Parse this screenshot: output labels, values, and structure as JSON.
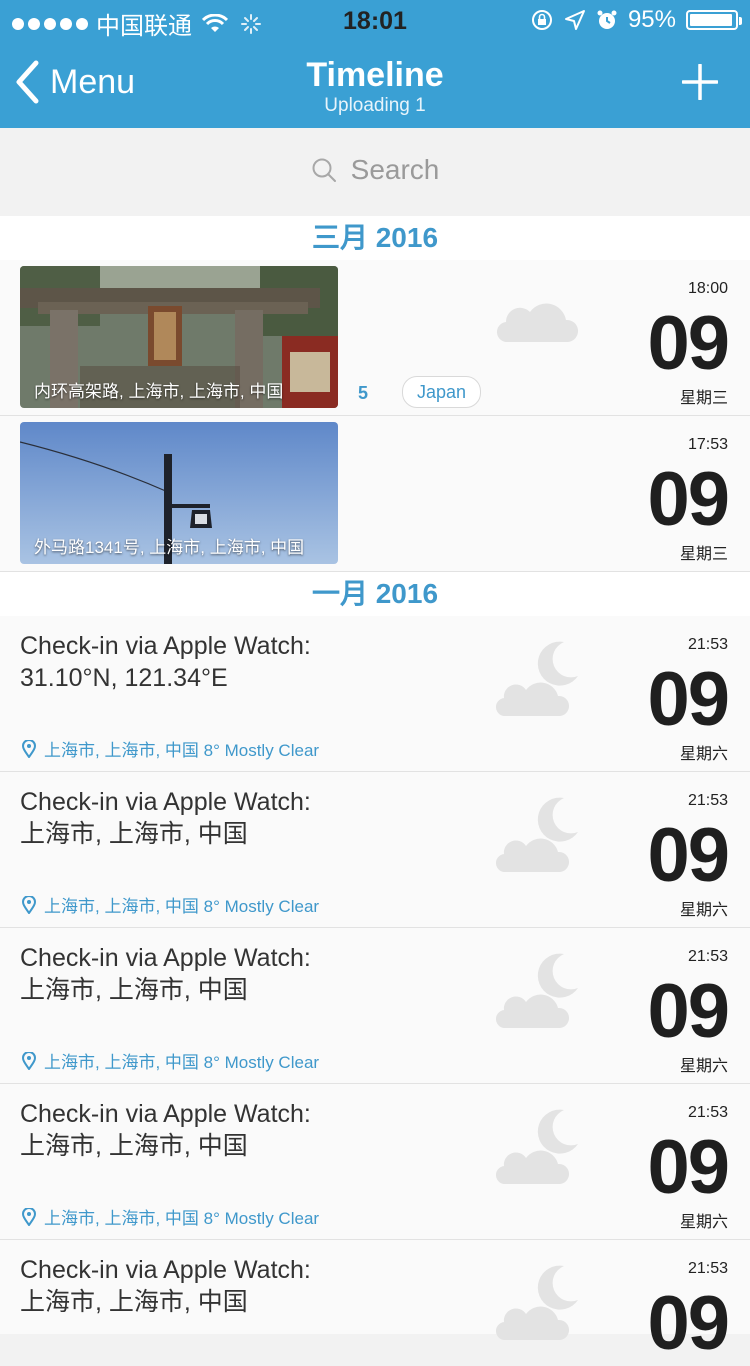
{
  "status": {
    "carrier": "中国联通",
    "time": "18:01",
    "battery_pct": "95%",
    "battery_level": 0.95
  },
  "nav": {
    "back_label": "Menu",
    "title": "Timeline",
    "subtitle": "Uploading 1"
  },
  "search": {
    "placeholder": "Search"
  },
  "sections": [
    {
      "label": "三月 2016"
    },
    {
      "label": "一月 2016"
    }
  ],
  "photo_entries": [
    {
      "caption": "内环高架路, 上海市, 上海市, 中国",
      "count": "5",
      "tag": "Japan",
      "time": "18:00",
      "day": "09",
      "weekday": "星期三",
      "weather": "cloud-icon"
    },
    {
      "caption": "外马路1341号, 上海市, 上海市, 中国",
      "time": "17:53",
      "day": "09",
      "weekday": "星期三"
    }
  ],
  "checkins": [
    {
      "title_line1": "Check-in via Apple Watch:",
      "title_line2": "31.10°N, 121.34°E",
      "location": "上海市, 上海市, 中国 8° Mostly Clear",
      "time": "21:53",
      "day": "09",
      "weekday": "星期六",
      "weather": "moon-cloud-icon"
    },
    {
      "title_line1": "Check-in via Apple Watch:",
      "title_line2": "上海市, 上海市, 中国",
      "location": "上海市, 上海市, 中国 8° Mostly Clear",
      "time": "21:53",
      "day": "09",
      "weekday": "星期六",
      "weather": "moon-cloud-icon"
    },
    {
      "title_line1": "Check-in via Apple Watch:",
      "title_line2": "上海市, 上海市, 中国",
      "location": "上海市, 上海市, 中国 8° Mostly Clear",
      "time": "21:53",
      "day": "09",
      "weekday": "星期六",
      "weather": "moon-cloud-icon"
    },
    {
      "title_line1": "Check-in via Apple Watch:",
      "title_line2": "上海市, 上海市, 中国",
      "location": "上海市, 上海市, 中国 8° Mostly Clear",
      "time": "21:53",
      "day": "09",
      "weekday": "星期六",
      "weather": "moon-cloud-icon"
    },
    {
      "title_line1": "Check-in via Apple Watch:",
      "title_line2": "上海市, 上海市, 中国",
      "time": "21:53",
      "day": "09",
      "weekday": "星期六",
      "weather": "moon-cloud-icon"
    }
  ],
  "colors": {
    "accent": "#3aa0d4",
    "link": "#3f98cb"
  }
}
